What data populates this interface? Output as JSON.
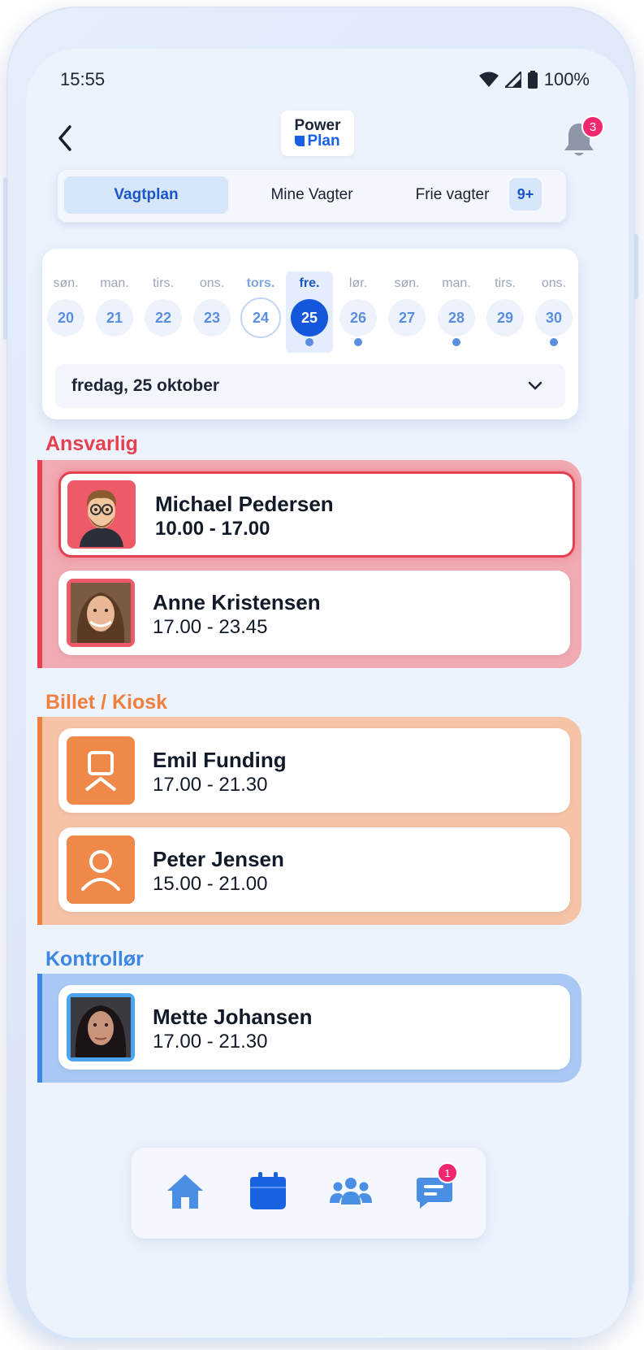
{
  "status": {
    "time": "15:55",
    "battery": "100%"
  },
  "header": {
    "logo_line1": "Power",
    "logo_line2": "Plan",
    "notifications_count": "3"
  },
  "tabs": [
    {
      "label": "Vagtplan",
      "active": true
    },
    {
      "label": "Mine Vagter",
      "active": false
    },
    {
      "label": "Frie vagter",
      "active": false,
      "badge": "9+"
    }
  ],
  "calendar": {
    "days": [
      {
        "weekday": "søn.",
        "date": "20"
      },
      {
        "weekday": "man.",
        "date": "21"
      },
      {
        "weekday": "tirs.",
        "date": "22"
      },
      {
        "weekday": "ons.",
        "date": "23"
      },
      {
        "weekday": "tors.",
        "date": "24"
      },
      {
        "weekday": "fre.",
        "date": "25"
      },
      {
        "weekday": "lør.",
        "date": "26"
      },
      {
        "weekday": "søn.",
        "date": "27"
      },
      {
        "weekday": "man.",
        "date": "28"
      },
      {
        "weekday": "tirs.",
        "date": "29"
      },
      {
        "weekday": "ons.",
        "date": "30"
      }
    ],
    "selected_date_label": "fredag, 25 oktober"
  },
  "sections": [
    {
      "title": "Ansvarlig",
      "color": "#e5404f",
      "shifts": [
        {
          "name": "Michael Pedersen",
          "time": "10.00 - 17.00"
        },
        {
          "name": "Anne Kristensen",
          "time": "17.00 - 23.45"
        }
      ]
    },
    {
      "title": "Billet / Kiosk",
      "color": "#ee7f3e",
      "shifts": [
        {
          "name": "Emil Funding",
          "time": "17.00 - 21.30"
        },
        {
          "name": "Peter Jensen",
          "time": "15.00 - 21.00"
        }
      ]
    },
    {
      "title": "Kontrollør",
      "color": "#3b87e5",
      "shifts": [
        {
          "name": "Mette Johansen",
          "time": "17.00 - 21.30"
        }
      ]
    }
  ],
  "bottom_nav": {
    "items": [
      "home-icon",
      "calendar-icon",
      "team-icon",
      "chat-icon"
    ],
    "active": "calendar-icon",
    "chat_badge": "1"
  }
}
